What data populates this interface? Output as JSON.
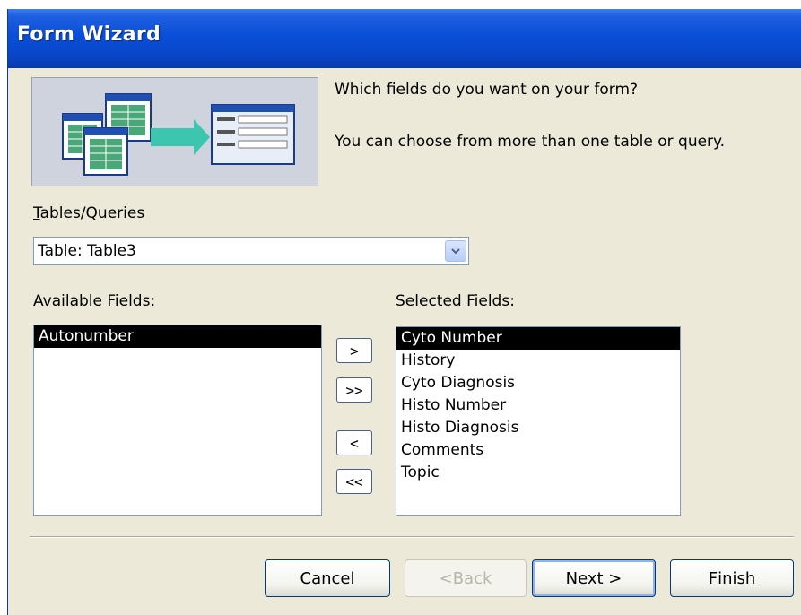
{
  "window": {
    "title": "Form Wizard"
  },
  "prompts": {
    "line1": "Which fields do you want on your form?",
    "line2": "You can choose from more than one table or query."
  },
  "tables_queries": {
    "label_prefix": "T",
    "label_rest": "ables/Queries",
    "selected": "Table: Table3"
  },
  "available": {
    "label_prefix": "A",
    "label_rest": "vailable Fields:",
    "items": [
      "Autonumber"
    ]
  },
  "selected_fields": {
    "label_prefix": "S",
    "label_rest": "elected Fields:",
    "items": [
      "Cyto Number",
      "History",
      "Cyto Diagnosis",
      "Histo Number",
      "Histo Diagnosis",
      "Comments",
      "Topic"
    ]
  },
  "move_buttons": {
    "add_one": ">",
    "add_all": ">>",
    "remove_one": "<",
    "remove_all": "<<"
  },
  "footer": {
    "cancel": "Cancel",
    "back_pre": "< ",
    "back_key": "B",
    "back_rest": "ack",
    "next_key": "N",
    "next_rest": "ext >",
    "finish_key": "F",
    "finish_rest": "inish"
  },
  "colors": {
    "titlebar": "#0a4fd8",
    "dialog": "#ece9d8",
    "selection": "#000000"
  }
}
